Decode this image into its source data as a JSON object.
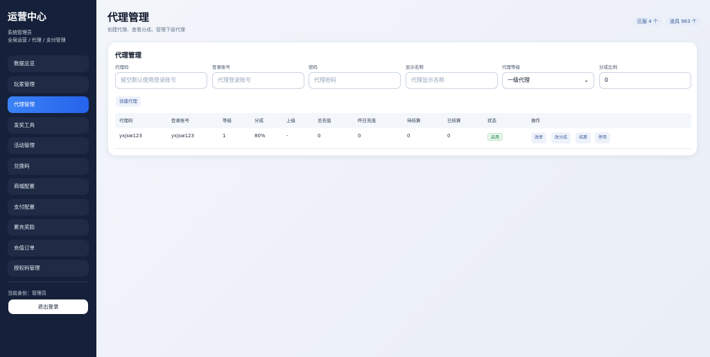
{
  "sidebar": {
    "brand": "运营中心",
    "role": "系统管理员",
    "scope": "全局运营 / 代理 / 支付管理",
    "items": [
      {
        "label": "数据总览"
      },
      {
        "label": "玩家管理"
      },
      {
        "label": "代理管理"
      },
      {
        "label": "发奖工具"
      },
      {
        "label": "活动管理"
      },
      {
        "label": "兑换码"
      },
      {
        "label": "商城配置"
      },
      {
        "label": "支付配置"
      },
      {
        "label": "累充奖励"
      },
      {
        "label": "充值订单"
      },
      {
        "label": "授权码管理"
      }
    ],
    "active_index": 2,
    "identity": "当前身份：管理员",
    "logout_label": "退出登录"
  },
  "header": {
    "title": "代理管理",
    "subtitle": "创建代理、查看分成、管理下级代理",
    "stats": [
      "区服 4 个",
      "道具 983 个"
    ]
  },
  "form": {
    "title": "代理管理",
    "fields": [
      {
        "label": "代理码",
        "placeholder": "留空默认使用登录账号"
      },
      {
        "label": "登录账号",
        "placeholder": "代理登录账号"
      },
      {
        "label": "密码",
        "placeholder": "代理密码"
      },
      {
        "label": "显示名称",
        "placeholder": "代理显示名称"
      },
      {
        "label": "代理等级",
        "value": "一级代理"
      },
      {
        "label": "分成比例",
        "value": "0"
      }
    ],
    "create_label": "创建代理"
  },
  "table": {
    "headers": [
      "代理码",
      "登录账号",
      "等级",
      "分成",
      "上级",
      "总充值",
      "昨日充值",
      "待结算",
      "已结算",
      "状态",
      "操作"
    ],
    "rows": [
      {
        "cells": [
          "yxjsw123",
          "yxjsw123",
          "1",
          "80%",
          "-",
          "0",
          "0",
          "0",
          "0"
        ],
        "status": "启用",
        "actions": [
          "改密",
          "改分成",
          "结算",
          "停用"
        ]
      }
    ]
  }
}
